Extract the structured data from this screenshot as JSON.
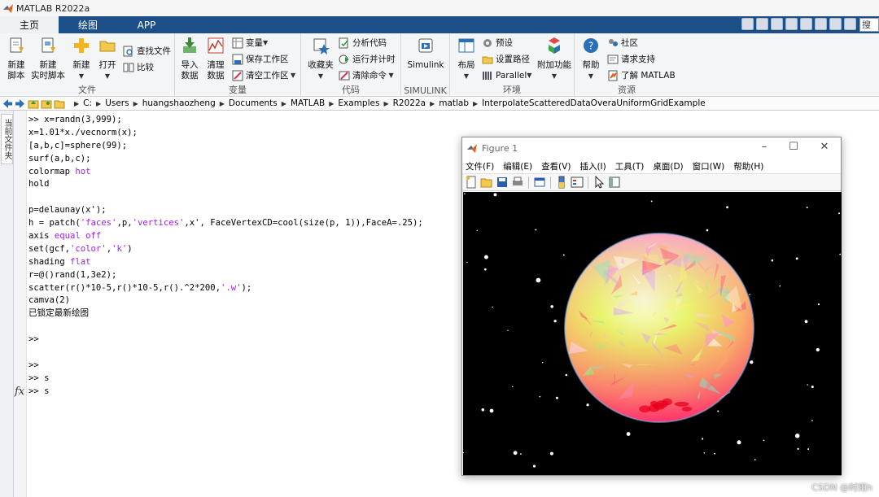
{
  "window": {
    "title": "MATLAB R2022a"
  },
  "tabs": [
    "主页",
    "绘图",
    "APP"
  ],
  "search": {
    "placeholder": "搜索"
  },
  "ribbon": {
    "file": {
      "label": "文件",
      "new_script": [
        "新建",
        "脚本"
      ],
      "new_live": [
        "新建",
        "实时脚本"
      ],
      "new": "新建",
      "open": "打开",
      "find_files": "查找文件",
      "compare": "比较"
    },
    "variable": {
      "label": "变量",
      "import": [
        "导入",
        "数据"
      ],
      "clean": [
        "清理",
        "数据"
      ],
      "variable": "变量",
      "save_ws": "保存工作区",
      "clear_ws": "清空工作区"
    },
    "code": {
      "label": "代码",
      "favorites": "收藏夹",
      "analyze": "分析代码",
      "run_time": "运行并计时",
      "clear_cmd": "清除命令"
    },
    "simulink": {
      "label": "SIMULINK",
      "button": "Simulink"
    },
    "environment": {
      "label": "环境",
      "layout": "布局",
      "preferences": "预设",
      "set_path": "设置路径",
      "parallel": "Parallel",
      "addons": "附加功能"
    },
    "resources": {
      "label": "资源",
      "help": "帮助",
      "community": "社区",
      "support": "请求支持",
      "learn": "了解 MATLAB"
    }
  },
  "path": [
    "C:",
    "Users",
    "huangshaozheng",
    "Documents",
    "MATLAB",
    "Examples",
    "R2022a",
    "matlab",
    "InterpolateScatteredDataOveraUniformGridExample"
  ],
  "side_panel": {
    "label": "当前文件夹"
  },
  "command_window": {
    "lines": [
      [
        {
          "t": ">> x=randn(3,999);"
        }
      ],
      [
        {
          "t": "x=1.01*x./vecnorm(x);"
        }
      ],
      [
        {
          "t": "[a,b,c]=sphere(99);"
        }
      ],
      [
        {
          "t": "surf(a,b,c);"
        }
      ],
      [
        {
          "t": "colormap "
        },
        {
          "t": "hot",
          "s": 1
        }
      ],
      [
        {
          "t": "hold"
        }
      ],
      [
        {
          "t": ""
        }
      ],
      [
        {
          "t": "p=delaunay(x');"
        }
      ],
      [
        {
          "t": "h = patch("
        },
        {
          "t": "'faces'",
          "s": 1
        },
        {
          "t": ",p,"
        },
        {
          "t": "'vertices'",
          "s": 1
        },
        {
          "t": ",x', FaceVertexCD=cool(size(p, 1)),FaceA=.25);"
        }
      ],
      [
        {
          "t": "axis "
        },
        {
          "t": "equal off",
          "s": 1
        }
      ],
      [
        {
          "t": "set(gcf,"
        },
        {
          "t": "'color'",
          "s": 1
        },
        {
          "t": ","
        },
        {
          "t": "'k'",
          "s": 1
        },
        {
          "t": ")"
        }
      ],
      [
        {
          "t": "shading "
        },
        {
          "t": "flat",
          "s": 1
        }
      ],
      [
        {
          "t": "r=@()rand(1,3e2);"
        }
      ],
      [
        {
          "t": "scatter(r()*10-5,r()*10-5,r().^2*200,"
        },
        {
          "t": "'.w'",
          "s": 1
        },
        {
          "t": ");"
        }
      ],
      [
        {
          "t": "camva(2)"
        }
      ],
      [
        {
          "t": "已锁定最新绘图",
          "zh": 1
        }
      ],
      [
        {
          "t": ""
        }
      ],
      [
        {
          "t": ">>"
        }
      ],
      [
        {
          "t": ""
        }
      ],
      [
        {
          "t": ">>"
        }
      ],
      [
        {
          "t": ">> s"
        }
      ],
      [
        {
          "t": ">> s"
        }
      ]
    ],
    "fx": "fx"
  },
  "figure": {
    "title": "Figure 1",
    "menu": [
      "文件(F)",
      "编辑(E)",
      "查看(V)",
      "插入(I)",
      "工具(T)",
      "桌面(D)",
      "窗口(W)",
      "帮助(H)"
    ],
    "toolbar_icons": [
      "new-figure-icon",
      "open-file-icon",
      "save-icon",
      "print-icon",
      "link-plot-icon",
      "insert-colorbar-icon",
      "insert-legend-icon",
      "edit-plot-icon",
      "property-inspector-icon"
    ],
    "colors": {
      "sphere_top": "#ff9ae8",
      "sphere_mid": "#e9f56a",
      "sphere_bottom": "#ff2d6e",
      "background": "#000000"
    }
  },
  "watermark": "CSDN @时雨h"
}
